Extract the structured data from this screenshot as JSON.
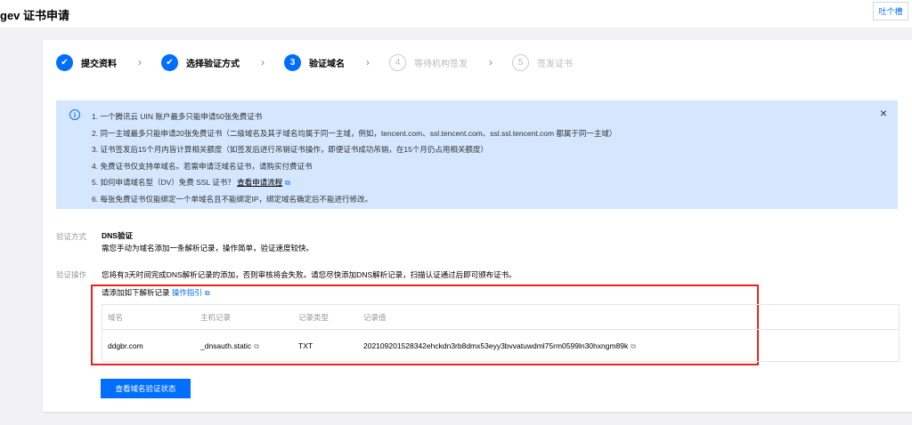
{
  "header": {
    "title": "gev 证书申请",
    "feedback": "吐个槽"
  },
  "steps": [
    {
      "num": "1",
      "label": "提交资料",
      "state": "done"
    },
    {
      "num": "2",
      "label": "选择验证方式",
      "state": "done"
    },
    {
      "num": "3",
      "label": "验证域名",
      "state": "active"
    },
    {
      "num": "4",
      "label": "等待机构签发",
      "state": "pending"
    },
    {
      "num": "5",
      "label": "签发证书",
      "state": "pending"
    }
  ],
  "notice": {
    "items": [
      "1. 一个腾讯云 UIN 账户最多只能申请50张免费证书",
      "2. 同一主域最多只能申请20张免费证书（二级域名及其子域名均属于同一主域，例如，tencent.com、ssl.tencent.com、ssl.ssl.tencent.com 都属于同一主域）",
      "3. 证书签发后15个月内皆计算相关额度（如签发后进行吊销证书操作，即便证书成功吊销，在15个月仍占用相关额度）",
      "4. 免费证书仅支持单域名。若需申请泛域名证书，请购买付费证书",
      "5. 如何申请域名型（DV）免费 SSL 证书？",
      "6. 每张免费证书仅能绑定一个单域名且不能绑定IP，绑定域名确定后不能进行修改。"
    ],
    "link": "查看申请流程"
  },
  "method": {
    "label": "验证方式",
    "title": "DNS验证",
    "desc": "需您手动为域名添加一条解析记录，操作简单，验证速度较快。"
  },
  "operation": {
    "label": "验证操作",
    "desc": "您将有3天时间完成DNS解析记录的添加，否则审核将会失败。请您尽快添加DNS解析记录，扫描认证通过后即可颁布证书。",
    "prompt": "请添加如下解析记录",
    "guide": "操作指引"
  },
  "table": {
    "headers": [
      "域名",
      "主机记录",
      "记录类型",
      "记录值"
    ],
    "rows": [
      [
        "ddgbr.com",
        "_dnsauth.static",
        "TXT",
        "202109201528342ehckdn3rb8dmx53eyy3bvvatuwdml75rm0599ln30hxngm89k"
      ]
    ]
  },
  "button": "查看域名验证状态"
}
